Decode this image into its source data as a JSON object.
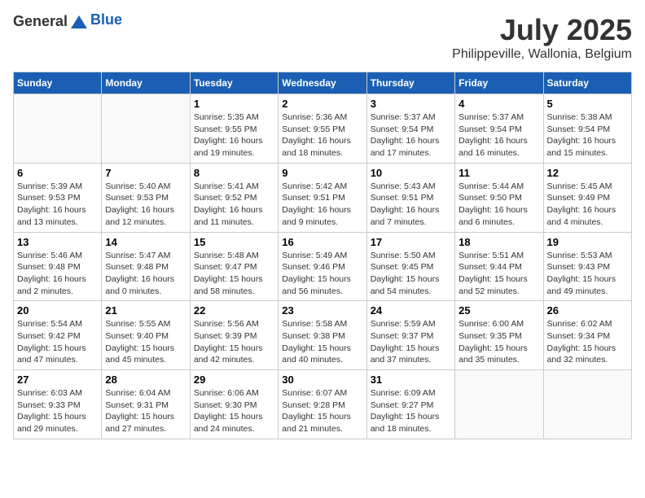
{
  "header": {
    "logo_general": "General",
    "logo_blue": "Blue",
    "month_title": "July 2025",
    "location": "Philippeville, Wallonia, Belgium"
  },
  "weekdays": [
    "Sunday",
    "Monday",
    "Tuesday",
    "Wednesday",
    "Thursday",
    "Friday",
    "Saturday"
  ],
  "weeks": [
    [
      {
        "day": "",
        "sunrise": "",
        "sunset": "",
        "daylight": ""
      },
      {
        "day": "",
        "sunrise": "",
        "sunset": "",
        "daylight": ""
      },
      {
        "day": "1",
        "sunrise": "Sunrise: 5:35 AM",
        "sunset": "Sunset: 9:55 PM",
        "daylight": "Daylight: 16 hours and 19 minutes."
      },
      {
        "day": "2",
        "sunrise": "Sunrise: 5:36 AM",
        "sunset": "Sunset: 9:55 PM",
        "daylight": "Daylight: 16 hours and 18 minutes."
      },
      {
        "day": "3",
        "sunrise": "Sunrise: 5:37 AM",
        "sunset": "Sunset: 9:54 PM",
        "daylight": "Daylight: 16 hours and 17 minutes."
      },
      {
        "day": "4",
        "sunrise": "Sunrise: 5:37 AM",
        "sunset": "Sunset: 9:54 PM",
        "daylight": "Daylight: 16 hours and 16 minutes."
      },
      {
        "day": "5",
        "sunrise": "Sunrise: 5:38 AM",
        "sunset": "Sunset: 9:54 PM",
        "daylight": "Daylight: 16 hours and 15 minutes."
      }
    ],
    [
      {
        "day": "6",
        "sunrise": "Sunrise: 5:39 AM",
        "sunset": "Sunset: 9:53 PM",
        "daylight": "Daylight: 16 hours and 13 minutes."
      },
      {
        "day": "7",
        "sunrise": "Sunrise: 5:40 AM",
        "sunset": "Sunset: 9:53 PM",
        "daylight": "Daylight: 16 hours and 12 minutes."
      },
      {
        "day": "8",
        "sunrise": "Sunrise: 5:41 AM",
        "sunset": "Sunset: 9:52 PM",
        "daylight": "Daylight: 16 hours and 11 minutes."
      },
      {
        "day": "9",
        "sunrise": "Sunrise: 5:42 AM",
        "sunset": "Sunset: 9:51 PM",
        "daylight": "Daylight: 16 hours and 9 minutes."
      },
      {
        "day": "10",
        "sunrise": "Sunrise: 5:43 AM",
        "sunset": "Sunset: 9:51 PM",
        "daylight": "Daylight: 16 hours and 7 minutes."
      },
      {
        "day": "11",
        "sunrise": "Sunrise: 5:44 AM",
        "sunset": "Sunset: 9:50 PM",
        "daylight": "Daylight: 16 hours and 6 minutes."
      },
      {
        "day": "12",
        "sunrise": "Sunrise: 5:45 AM",
        "sunset": "Sunset: 9:49 PM",
        "daylight": "Daylight: 16 hours and 4 minutes."
      }
    ],
    [
      {
        "day": "13",
        "sunrise": "Sunrise: 5:46 AM",
        "sunset": "Sunset: 9:48 PM",
        "daylight": "Daylight: 16 hours and 2 minutes."
      },
      {
        "day": "14",
        "sunrise": "Sunrise: 5:47 AM",
        "sunset": "Sunset: 9:48 PM",
        "daylight": "Daylight: 16 hours and 0 minutes."
      },
      {
        "day": "15",
        "sunrise": "Sunrise: 5:48 AM",
        "sunset": "Sunset: 9:47 PM",
        "daylight": "Daylight: 15 hours and 58 minutes."
      },
      {
        "day": "16",
        "sunrise": "Sunrise: 5:49 AM",
        "sunset": "Sunset: 9:46 PM",
        "daylight": "Daylight: 15 hours and 56 minutes."
      },
      {
        "day": "17",
        "sunrise": "Sunrise: 5:50 AM",
        "sunset": "Sunset: 9:45 PM",
        "daylight": "Daylight: 15 hours and 54 minutes."
      },
      {
        "day": "18",
        "sunrise": "Sunrise: 5:51 AM",
        "sunset": "Sunset: 9:44 PM",
        "daylight": "Daylight: 15 hours and 52 minutes."
      },
      {
        "day": "19",
        "sunrise": "Sunrise: 5:53 AM",
        "sunset": "Sunset: 9:43 PM",
        "daylight": "Daylight: 15 hours and 49 minutes."
      }
    ],
    [
      {
        "day": "20",
        "sunrise": "Sunrise: 5:54 AM",
        "sunset": "Sunset: 9:42 PM",
        "daylight": "Daylight: 15 hours and 47 minutes."
      },
      {
        "day": "21",
        "sunrise": "Sunrise: 5:55 AM",
        "sunset": "Sunset: 9:40 PM",
        "daylight": "Daylight: 15 hours and 45 minutes."
      },
      {
        "day": "22",
        "sunrise": "Sunrise: 5:56 AM",
        "sunset": "Sunset: 9:39 PM",
        "daylight": "Daylight: 15 hours and 42 minutes."
      },
      {
        "day": "23",
        "sunrise": "Sunrise: 5:58 AM",
        "sunset": "Sunset: 9:38 PM",
        "daylight": "Daylight: 15 hours and 40 minutes."
      },
      {
        "day": "24",
        "sunrise": "Sunrise: 5:59 AM",
        "sunset": "Sunset: 9:37 PM",
        "daylight": "Daylight: 15 hours and 37 minutes."
      },
      {
        "day": "25",
        "sunrise": "Sunrise: 6:00 AM",
        "sunset": "Sunset: 9:35 PM",
        "daylight": "Daylight: 15 hours and 35 minutes."
      },
      {
        "day": "26",
        "sunrise": "Sunrise: 6:02 AM",
        "sunset": "Sunset: 9:34 PM",
        "daylight": "Daylight: 15 hours and 32 minutes."
      }
    ],
    [
      {
        "day": "27",
        "sunrise": "Sunrise: 6:03 AM",
        "sunset": "Sunset: 9:33 PM",
        "daylight": "Daylight: 15 hours and 29 minutes."
      },
      {
        "day": "28",
        "sunrise": "Sunrise: 6:04 AM",
        "sunset": "Sunset: 9:31 PM",
        "daylight": "Daylight: 15 hours and 27 minutes."
      },
      {
        "day": "29",
        "sunrise": "Sunrise: 6:06 AM",
        "sunset": "Sunset: 9:30 PM",
        "daylight": "Daylight: 15 hours and 24 minutes."
      },
      {
        "day": "30",
        "sunrise": "Sunrise: 6:07 AM",
        "sunset": "Sunset: 9:28 PM",
        "daylight": "Daylight: 15 hours and 21 minutes."
      },
      {
        "day": "31",
        "sunrise": "Sunrise: 6:09 AM",
        "sunset": "Sunset: 9:27 PM",
        "daylight": "Daylight: 15 hours and 18 minutes."
      },
      {
        "day": "",
        "sunrise": "",
        "sunset": "",
        "daylight": ""
      },
      {
        "day": "",
        "sunrise": "",
        "sunset": "",
        "daylight": ""
      }
    ]
  ]
}
